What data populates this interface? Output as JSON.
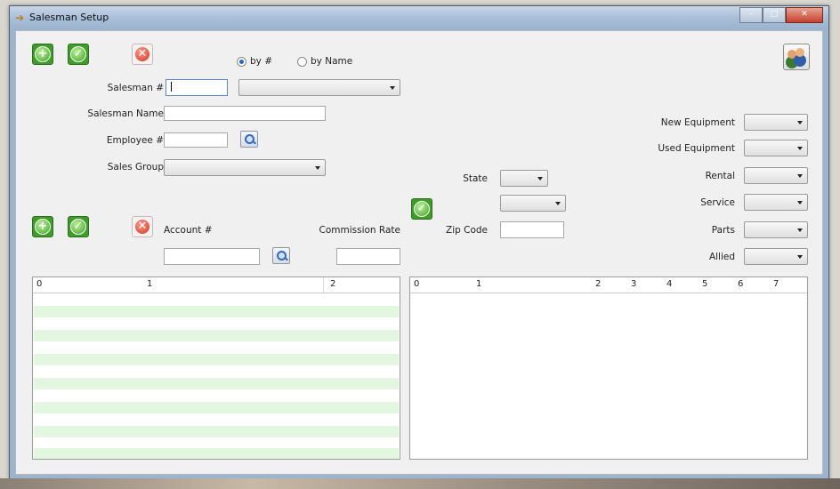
{
  "window": {
    "title": "Salesman Setup",
    "icon": "arrow-app-icon"
  },
  "toolbar": {
    "add": "add-icon",
    "save": "check-icon",
    "delete": "delete-icon"
  },
  "search_mode": {
    "options": [
      {
        "label": "by #",
        "selected": true
      },
      {
        "label": "by Name",
        "selected": false
      }
    ]
  },
  "salesman": {
    "number_label": "Salesman #",
    "number_value": "",
    "lookup_value": "",
    "name_label": "Salesman Name",
    "name_value": "",
    "employee_label": "Employee #",
    "employee_value": "",
    "sales_group_label": "Sales Group",
    "sales_group_value": ""
  },
  "account_section": {
    "account_label": "Account #",
    "account_value": "",
    "commission_label": "Commission Rate",
    "commission_value": ""
  },
  "location": {
    "state_label": "State",
    "state_value": "",
    "county_value": "",
    "zip_label": "Zip Code",
    "zip_value": ""
  },
  "categories": [
    {
      "label": "New Equipment",
      "value": ""
    },
    {
      "label": "Used Equipment",
      "value": ""
    },
    {
      "label": "Rental",
      "value": ""
    },
    {
      "label": "Service",
      "value": ""
    },
    {
      "label": "Parts",
      "value": ""
    },
    {
      "label": "Allied",
      "value": ""
    }
  ],
  "left_grid": {
    "columns": [
      "0",
      "1",
      "2"
    ]
  },
  "right_grid": {
    "columns": [
      "0",
      "1",
      "2",
      "3",
      "4",
      "5",
      "6",
      "7"
    ]
  },
  "colors": {
    "accent_green": "#3e9d2a",
    "accent_red": "#d3321e",
    "row_alt": "#e3f6df"
  }
}
